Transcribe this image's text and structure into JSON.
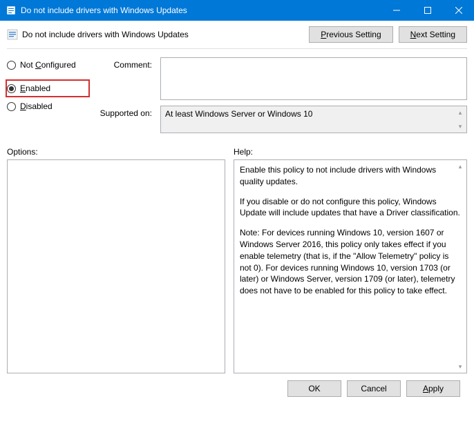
{
  "titlebar": {
    "title": "Do not include drivers with Windows Updates"
  },
  "header": {
    "title": "Do not include drivers with Windows Updates",
    "previous": "Previous Setting",
    "next": "Next Setting"
  },
  "radio": {
    "not_configured": "Not Configured",
    "enabled": "Enabled",
    "disabled": "Disabled",
    "selected": "enabled"
  },
  "fields": {
    "comment_label": "Comment:",
    "comment_value": "",
    "supported_label": "Supported on:",
    "supported_value": "At least Windows Server or Windows 10"
  },
  "panels": {
    "options_label": "Options:",
    "help_label": "Help:"
  },
  "help": {
    "p1": "Enable this policy to not include drivers with Windows quality updates.",
    "p2": "If you disable or do not configure this policy, Windows Update will include updates that have a Driver classification.",
    "p3": "Note: For devices running Windows 10, version 1607 or Windows Server 2016, this policy only takes effect if you enable telemetry (that is, if the \"Allow Telemetry\" policy is not 0). For devices running Windows 10, version 1703 (or later) or Windows Server, version 1709 (or later), telemetry does not have to be enabled for this policy to take effect."
  },
  "footer": {
    "ok": "OK",
    "cancel": "Cancel",
    "apply": "Apply"
  }
}
